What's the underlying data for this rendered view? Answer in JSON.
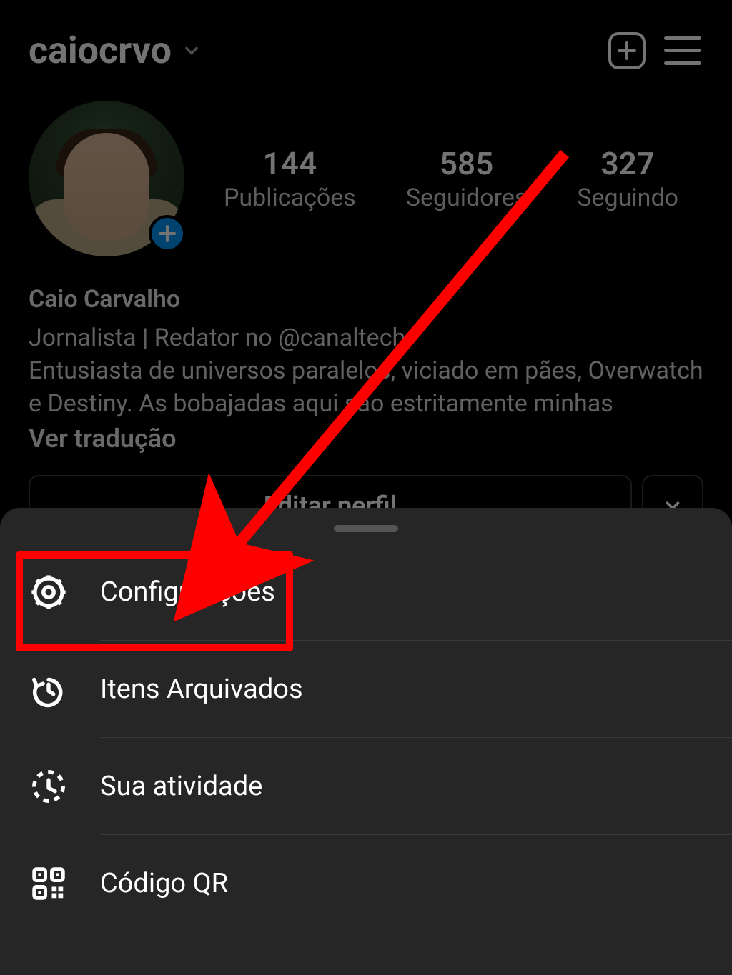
{
  "header": {
    "username": "caiocrvo"
  },
  "stats": {
    "posts": {
      "count": "144",
      "label": "Publicações"
    },
    "followers": {
      "count": "585",
      "label": "Seguidores"
    },
    "following": {
      "count": "327",
      "label": "Seguindo"
    }
  },
  "bio": {
    "display_name": "Caio Carvalho",
    "line1": "Jornalista | Redator no @canaltech",
    "line2": "Entusiasta de universos paralelos, viciado em pães, Overwatch e Destiny. As bobajadas aqui são estritamente minhas",
    "translate_label": "Ver tradução"
  },
  "buttons": {
    "edit_profile": "Editar perfil"
  },
  "menu": {
    "settings": "Configurações",
    "archive": "Itens Arquivados",
    "activity": "Sua atividade",
    "qr": "Código QR"
  }
}
